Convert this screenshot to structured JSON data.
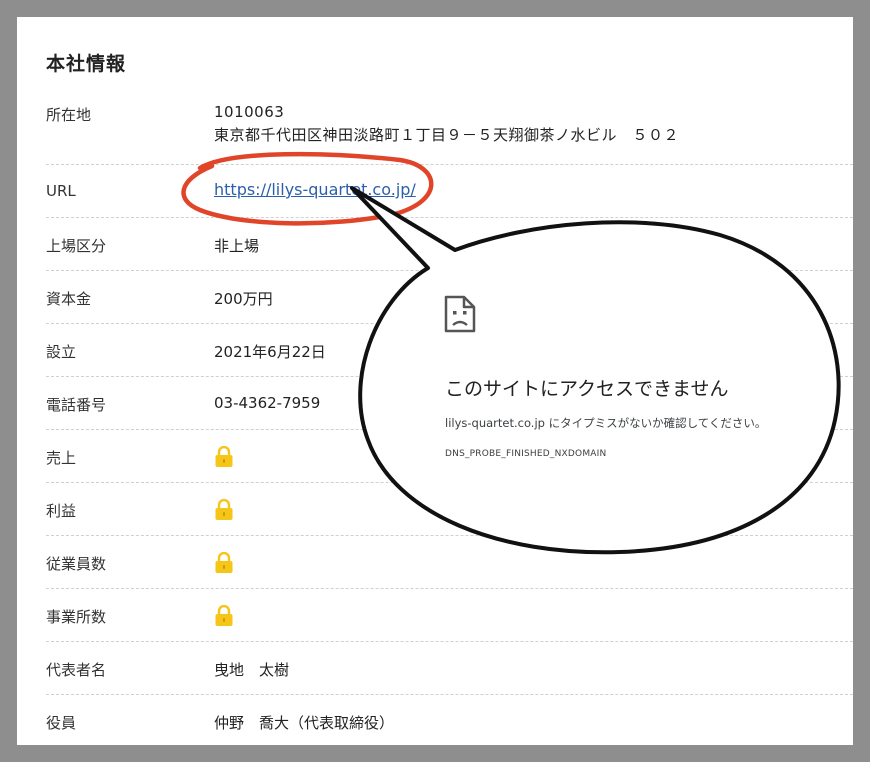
{
  "section": {
    "title": "本社情報"
  },
  "rows": {
    "address": {
      "label": "所在地",
      "postal": "1010063",
      "street": "東京都千代田区神田淡路町１丁目９－５天翔御茶ノ水ビル　５０２"
    },
    "url": {
      "label": "URL",
      "link": "https://lilys-quartet.co.jp/"
    },
    "listing": {
      "label": "上場区分",
      "value": "非上場"
    },
    "capital": {
      "label": "資本金",
      "value": "200万円"
    },
    "founded": {
      "label": "設立",
      "value": "2021年6月22日"
    },
    "phone": {
      "label": "電話番号",
      "value": "03-4362-7959"
    },
    "sales": {
      "label": "売上",
      "icon": "lock-icon"
    },
    "profit": {
      "label": "利益",
      "icon": "lock-icon"
    },
    "employees": {
      "label": "従業員数",
      "icon": "lock-icon"
    },
    "offices": {
      "label": "事業所数",
      "icon": "lock-icon"
    },
    "representative": {
      "label": "代表者名",
      "value": "曳地　太樹"
    },
    "officers": {
      "label": "役員",
      "value": "仲野　喬大（代表取締役）"
    }
  },
  "error_bubble": {
    "icon": "sad-page-icon",
    "title": "このサイトにアクセスできません",
    "description": "lilys-quartet.co.jp にタイプミスがないか確認してください。",
    "code": "DNS_PROBE_FINISHED_NXDOMAIN"
  },
  "colors": {
    "link": "#2b5fad",
    "annotation_circle": "#e0452a",
    "lock": "#f5c518",
    "frame": "#8e8e8e"
  }
}
